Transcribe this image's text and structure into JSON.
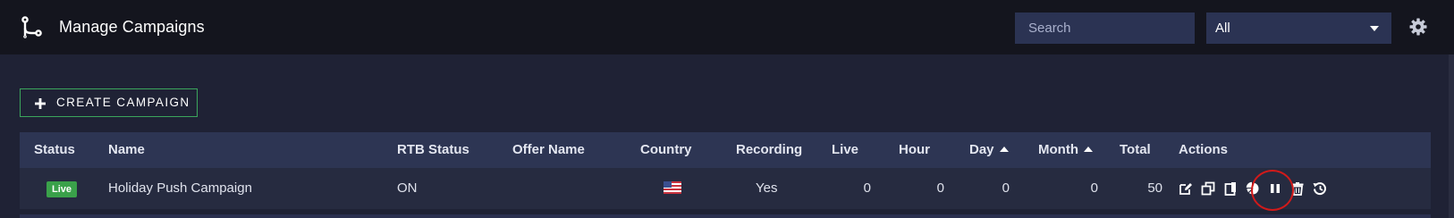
{
  "header": {
    "title": "Manage Campaigns",
    "search_placeholder": "Search",
    "filter_value": "All"
  },
  "toolbar": {
    "create_label": "CREATE CAMPAIGN"
  },
  "table": {
    "columns": [
      "Status",
      "Name",
      "RTB Status",
      "Offer Name",
      "Country",
      "Recording",
      "Live",
      "Hour",
      "Day",
      "Month",
      "Total",
      "Actions"
    ],
    "rows": [
      {
        "status": "Live",
        "name": "Holiday Push Campaign",
        "rtb_status": "ON",
        "offer_name": "",
        "country": "us-flag-icon",
        "recording": "Yes",
        "live": "0",
        "hour": "0",
        "day": "0",
        "month": "0",
        "total": "50",
        "actions": [
          "edit-icon",
          "copy-icon",
          "clipboard-icon",
          "pie-chart-icon",
          "pause-icon",
          "trash-icon",
          "history-icon"
        ]
      }
    ]
  },
  "colors": {
    "topbar": "#14151e",
    "body": "#1f2235",
    "accent_green": "#3ba55c",
    "badge_green": "#3aa14a",
    "highlight_red": "#d11a1a"
  }
}
